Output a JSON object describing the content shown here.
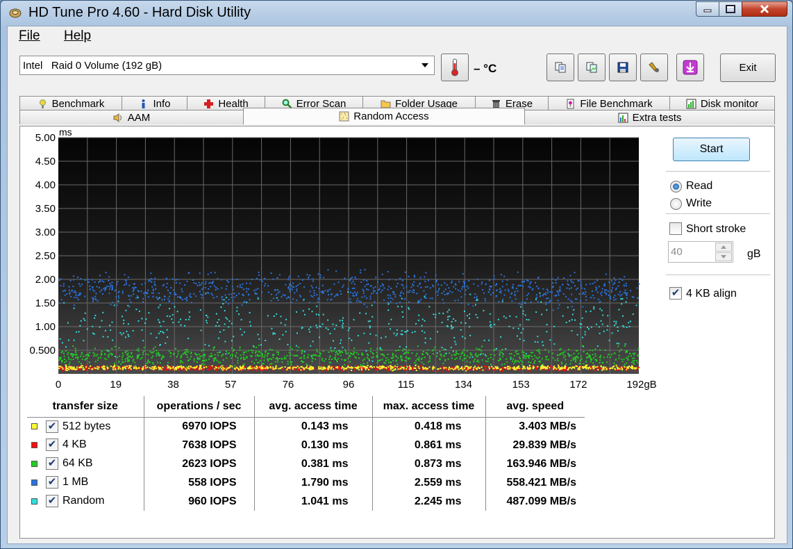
{
  "window": {
    "title": "HD Tune Pro 4.60 - Hard Disk Utility"
  },
  "menu": [
    "File",
    "Help"
  ],
  "toolbar": {
    "drive": "Intel   Raid 0 Volume (192 gB)",
    "temperature": "– °C",
    "icons": [
      "thermometer-icon",
      "copy-text-icon",
      "copy-image-icon",
      "save-icon",
      "options-icon",
      "download-icon"
    ],
    "exit_label": "Exit"
  },
  "tabs_row1": [
    {
      "label": "Benchmark",
      "icon": "benchmark-icon"
    },
    {
      "label": "Info",
      "icon": "info-icon"
    },
    {
      "label": "Health",
      "icon": "health-icon"
    },
    {
      "label": "Error Scan",
      "icon": "error-scan-icon"
    },
    {
      "label": "Folder Usage",
      "icon": "folder-icon"
    },
    {
      "label": "Erase",
      "icon": "erase-icon"
    },
    {
      "label": "File Benchmark",
      "icon": "file-benchmark-icon"
    },
    {
      "label": "Disk monitor",
      "icon": "disk-monitor-icon"
    }
  ],
  "tabs_row2": [
    {
      "label": "AAM",
      "icon": "speaker-icon"
    },
    {
      "label": "Random Access",
      "icon": "random-access-icon",
      "active": true
    },
    {
      "label": "Extra tests",
      "icon": "extra-tests-icon"
    }
  ],
  "controls": {
    "start_label": "Start",
    "read_label": "Read",
    "write_label": "Write",
    "mode": "Read",
    "short_stroke_label": "Short stroke",
    "short_stroke_checked": false,
    "short_stroke_value": "40",
    "short_stroke_unit": "gB",
    "align_label": "4 KB align",
    "align_checked": true
  },
  "results": {
    "headers": [
      "transfer size",
      "operations / sec",
      "avg. access time",
      "max. access time",
      "avg. speed"
    ],
    "rows": [
      {
        "size": "512 bytes",
        "color": "#ffff33",
        "checked": true,
        "ops": "6970 IOPS",
        "avg": "0.143 ms",
        "max": "0.418 ms",
        "speed": "3.403 MB/s"
      },
      {
        "size": "4 KB",
        "color": "#ee1111",
        "checked": true,
        "ops": "7638 IOPS",
        "avg": "0.130 ms",
        "max": "0.861 ms",
        "speed": "29.839 MB/s"
      },
      {
        "size": "64 KB",
        "color": "#22cc22",
        "checked": true,
        "ops": "2623 IOPS",
        "avg": "0.381 ms",
        "max": "0.873 ms",
        "speed": "163.946 MB/s"
      },
      {
        "size": "1 MB",
        "color": "#2a73dd",
        "checked": true,
        "ops": "558 IOPS",
        "avg": "1.790 ms",
        "max": "2.559 ms",
        "speed": "558.421 MB/s"
      },
      {
        "size": "Random",
        "color": "#33dddd",
        "checked": true,
        "ops": "960 IOPS",
        "avg": "1.041 ms",
        "max": "2.245 ms",
        "speed": "487.099 MB/s"
      }
    ]
  },
  "chart_data": {
    "type": "scatter",
    "ylabel": "ms",
    "ylim": [
      0,
      5
    ],
    "xlim": [
      0,
      192
    ],
    "y_ticks": [
      "5.00",
      "4.50",
      "4.00",
      "3.50",
      "3.00",
      "2.50",
      "2.00",
      "1.50",
      "1.00",
      "0.500"
    ],
    "y_tick_values": [
      5,
      4.5,
      4,
      3.5,
      3,
      2.5,
      2,
      1.5,
      1,
      0.5
    ],
    "x_ticks": [
      "0",
      "19",
      "38",
      "57",
      "76",
      "96",
      "115",
      "134",
      "153",
      "172",
      "192gB"
    ],
    "x_tick_values": [
      0,
      19,
      38,
      57,
      76,
      96,
      115,
      134,
      153,
      172,
      192
    ],
    "grid": true,
    "background": "dark",
    "series": [
      {
        "name": "512 bytes",
        "color": "#ffff33",
        "y_center": 0.143,
        "y_spread": 0.06,
        "points": 700
      },
      {
        "name": "4 KB",
        "color": "#ee1111",
        "y_center": 0.13,
        "y_spread": 0.07,
        "points": 700
      },
      {
        "name": "64 KB",
        "color": "#22cc22",
        "y_center": 0.381,
        "y_spread": 0.25,
        "points": 900
      },
      {
        "name": "1 MB",
        "color": "#2a73dd",
        "y_center": 1.79,
        "y_spread": 0.45,
        "points": 900
      },
      {
        "name": "Random",
        "color": "#33dddd",
        "y_center": 1.041,
        "y_spread": 0.8,
        "points": 450
      }
    ]
  }
}
